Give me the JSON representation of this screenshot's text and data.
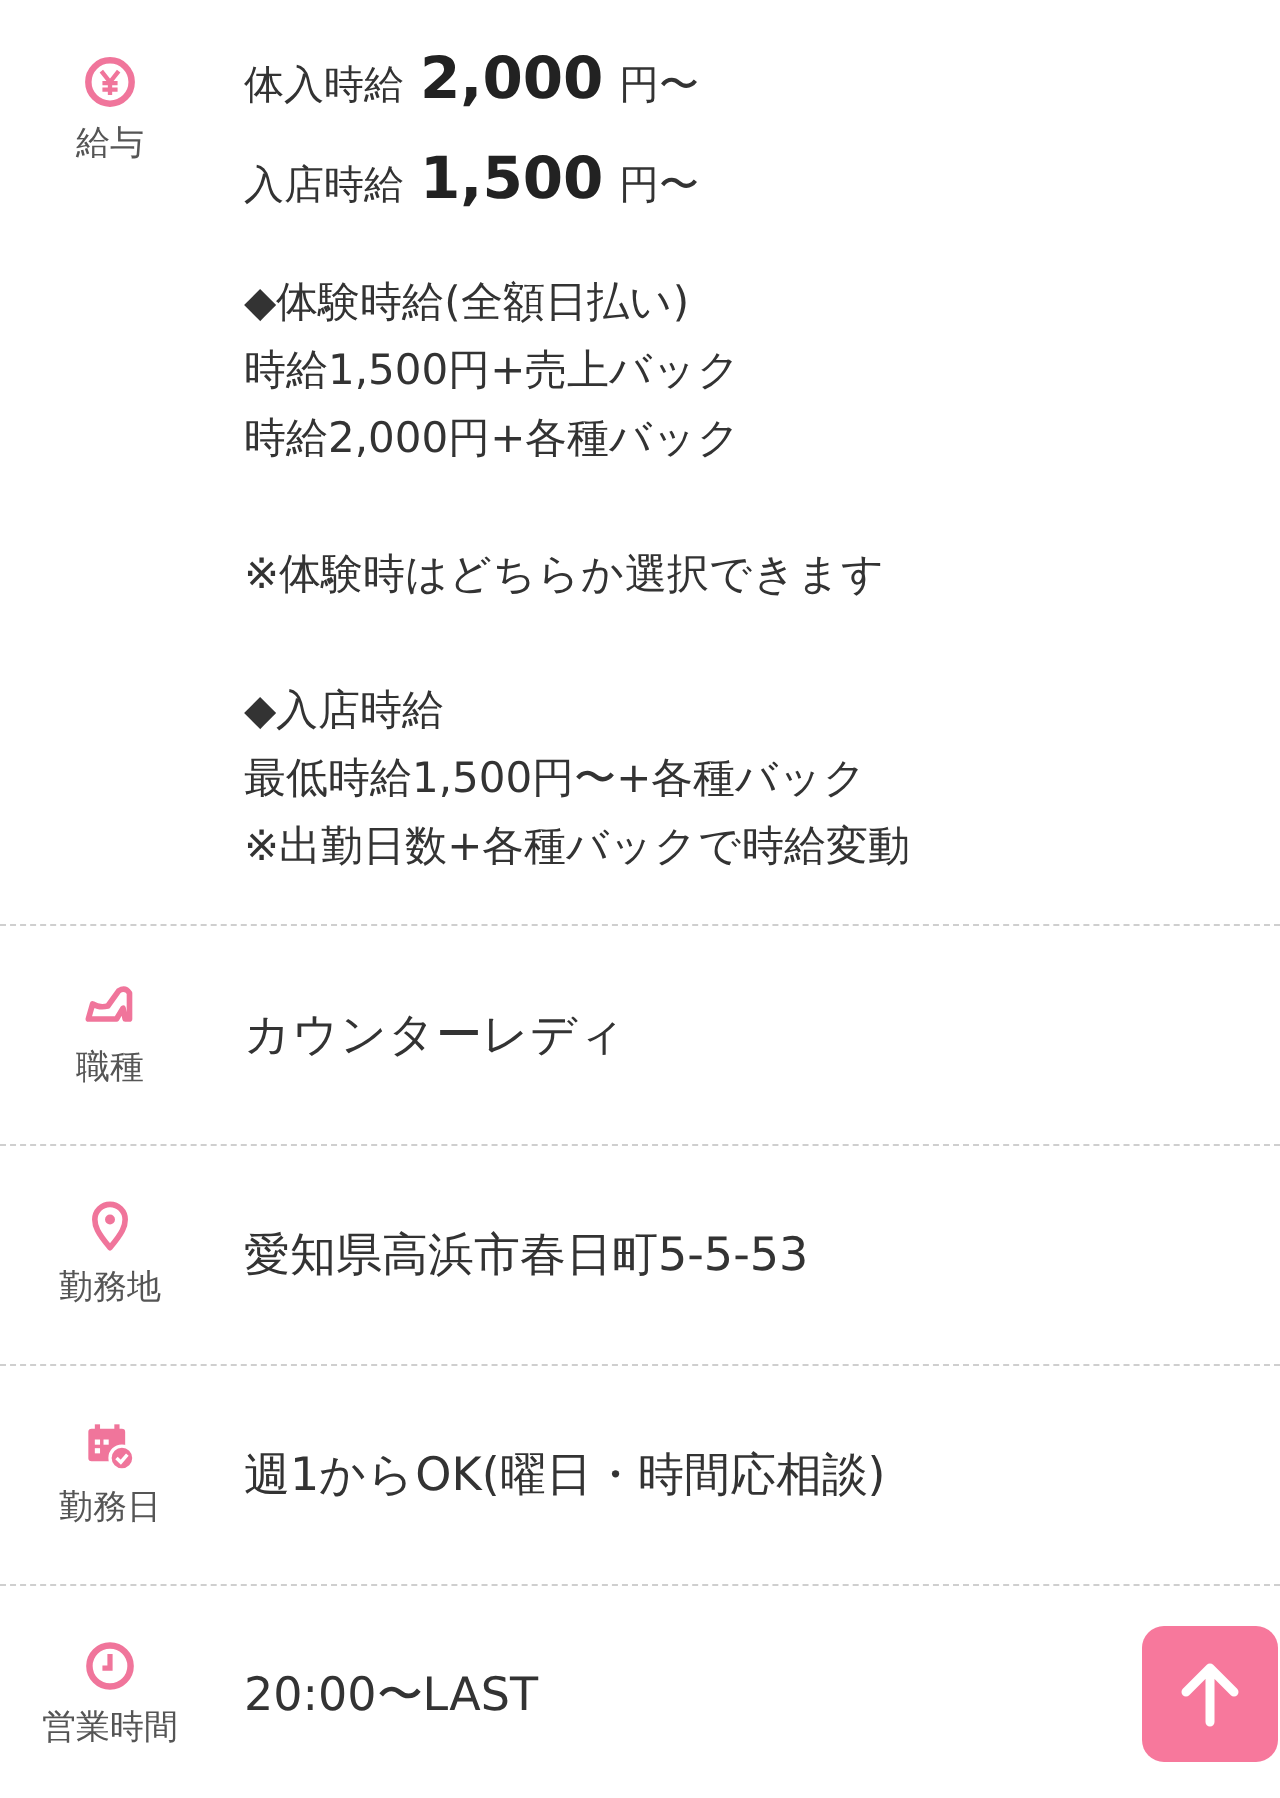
{
  "rows": [
    {
      "kind": "salary",
      "label": "給与",
      "wages": [
        {
          "label": "体入時給",
          "amount": "2,000",
          "unit": "円〜"
        },
        {
          "label": "入店時給",
          "amount": "1,500",
          "unit": "円〜"
        }
      ],
      "notes": [
        [
          "◆体験時給(全額日払い)",
          "時給1,500円+売上バック",
          "時給2,000円+各種バック"
        ],
        [
          "※体験時はどちらか選択できます"
        ],
        [
          "◆入店時給",
          "最低時給1,500円〜+各種バック",
          "※出勤日数+各種バックで時給変動"
        ]
      ]
    },
    {
      "kind": "text",
      "label": "職種",
      "value": "カウンターレディ"
    },
    {
      "kind": "text",
      "label": "勤務地",
      "value": "愛知県高浜市春日町5-5-53"
    },
    {
      "kind": "text",
      "label": "勤務日",
      "value": "週1からOK(曜日・時間応相談)"
    },
    {
      "kind": "text",
      "label": "営業時間",
      "value": "20:00〜LAST"
    }
  ]
}
